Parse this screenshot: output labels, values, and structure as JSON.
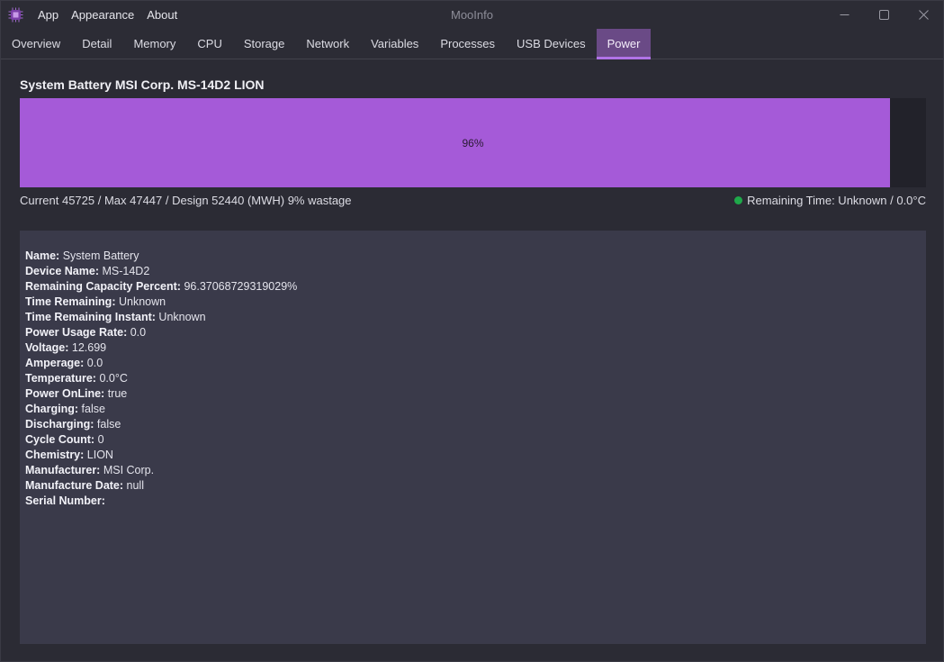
{
  "app": {
    "title": "MooInfo",
    "menu": [
      "App",
      "Appearance",
      "About"
    ]
  },
  "tabs": [
    {
      "label": "Overview"
    },
    {
      "label": "Detail"
    },
    {
      "label": "Memory"
    },
    {
      "label": "CPU"
    },
    {
      "label": "Storage"
    },
    {
      "label": "Network"
    },
    {
      "label": "Variables"
    },
    {
      "label": "Processes"
    },
    {
      "label": "USB Devices"
    },
    {
      "label": "Power",
      "active": true
    }
  ],
  "battery": {
    "title": "System Battery MSI Corp. MS-14D2 LION",
    "percent": 0.96,
    "percent_label": "96%",
    "capacity_line": "Current 45725 / Max 47447 / Design 52440 (MWH) 9% wastage",
    "remaining_line": "Remaining Time: Unknown / 0.0°C",
    "status_color": "#1fa84a",
    "fill_color": "#a55ad8"
  },
  "details": [
    {
      "key": "Name:",
      "value": "System Battery"
    },
    {
      "key": "Device Name:",
      "value": "MS-14D2"
    },
    {
      "key": "Remaining Capacity Percent:",
      "value": "96.37068729319029%"
    },
    {
      "key": "Time Remaining:",
      "value": "Unknown"
    },
    {
      "key": "Time Remaining Instant:",
      "value": "Unknown"
    },
    {
      "key": "Power Usage Rate:",
      "value": "0.0"
    },
    {
      "key": "Voltage:",
      "value": "12.699"
    },
    {
      "key": "Amperage:",
      "value": "0.0"
    },
    {
      "key": "Temperature:",
      "value": "0.0°C"
    },
    {
      "key": "Power OnLine:",
      "value": "true"
    },
    {
      "key": "Charging:",
      "value": "false"
    },
    {
      "key": "Discharging:",
      "value": "false"
    },
    {
      "key": "Cycle Count:",
      "value": "0"
    },
    {
      "key": "Chemistry:",
      "value": "LION"
    },
    {
      "key": "Manufacturer:",
      "value": "MSI Corp."
    },
    {
      "key": "Manufacture Date:",
      "value": "null"
    },
    {
      "key": "Serial Number:",
      "value": ""
    }
  ],
  "icons": {
    "app": "chip-icon",
    "minimize": "minimize-icon",
    "maximize": "maximize-icon",
    "close": "close-icon"
  }
}
